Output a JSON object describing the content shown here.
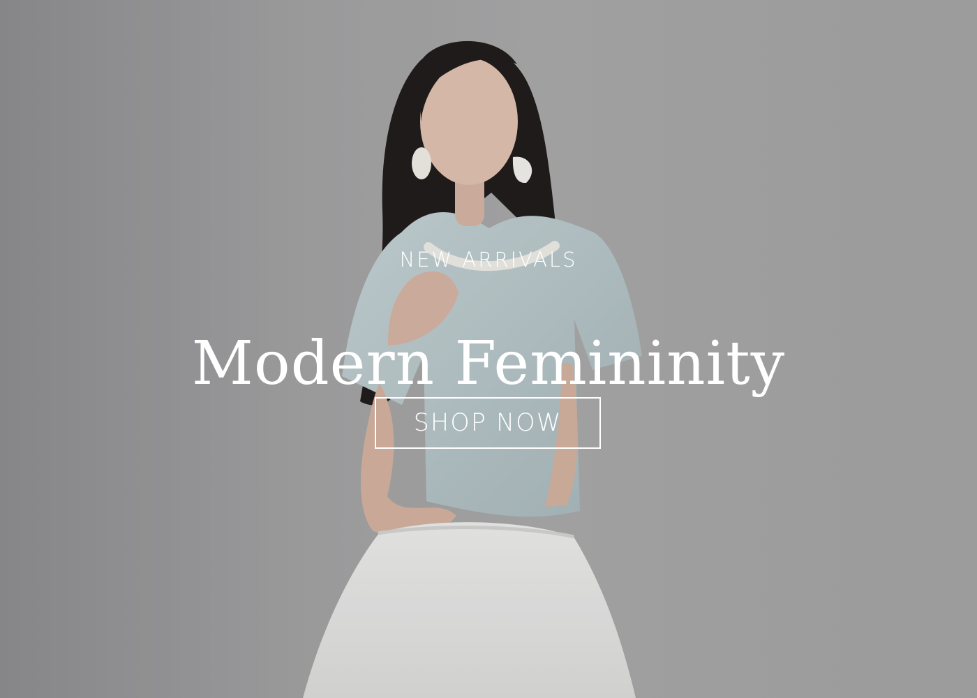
{
  "hero": {
    "eyebrow": "NEW ARRIVALS",
    "headline": "Modern Femininity",
    "cta_label": "SHOP NOW"
  },
  "colors": {
    "text": "#ffffff",
    "background": "#a3a3a3",
    "top": "#bcccce",
    "skirt": "#ececea",
    "hair": "#1f1a18"
  }
}
